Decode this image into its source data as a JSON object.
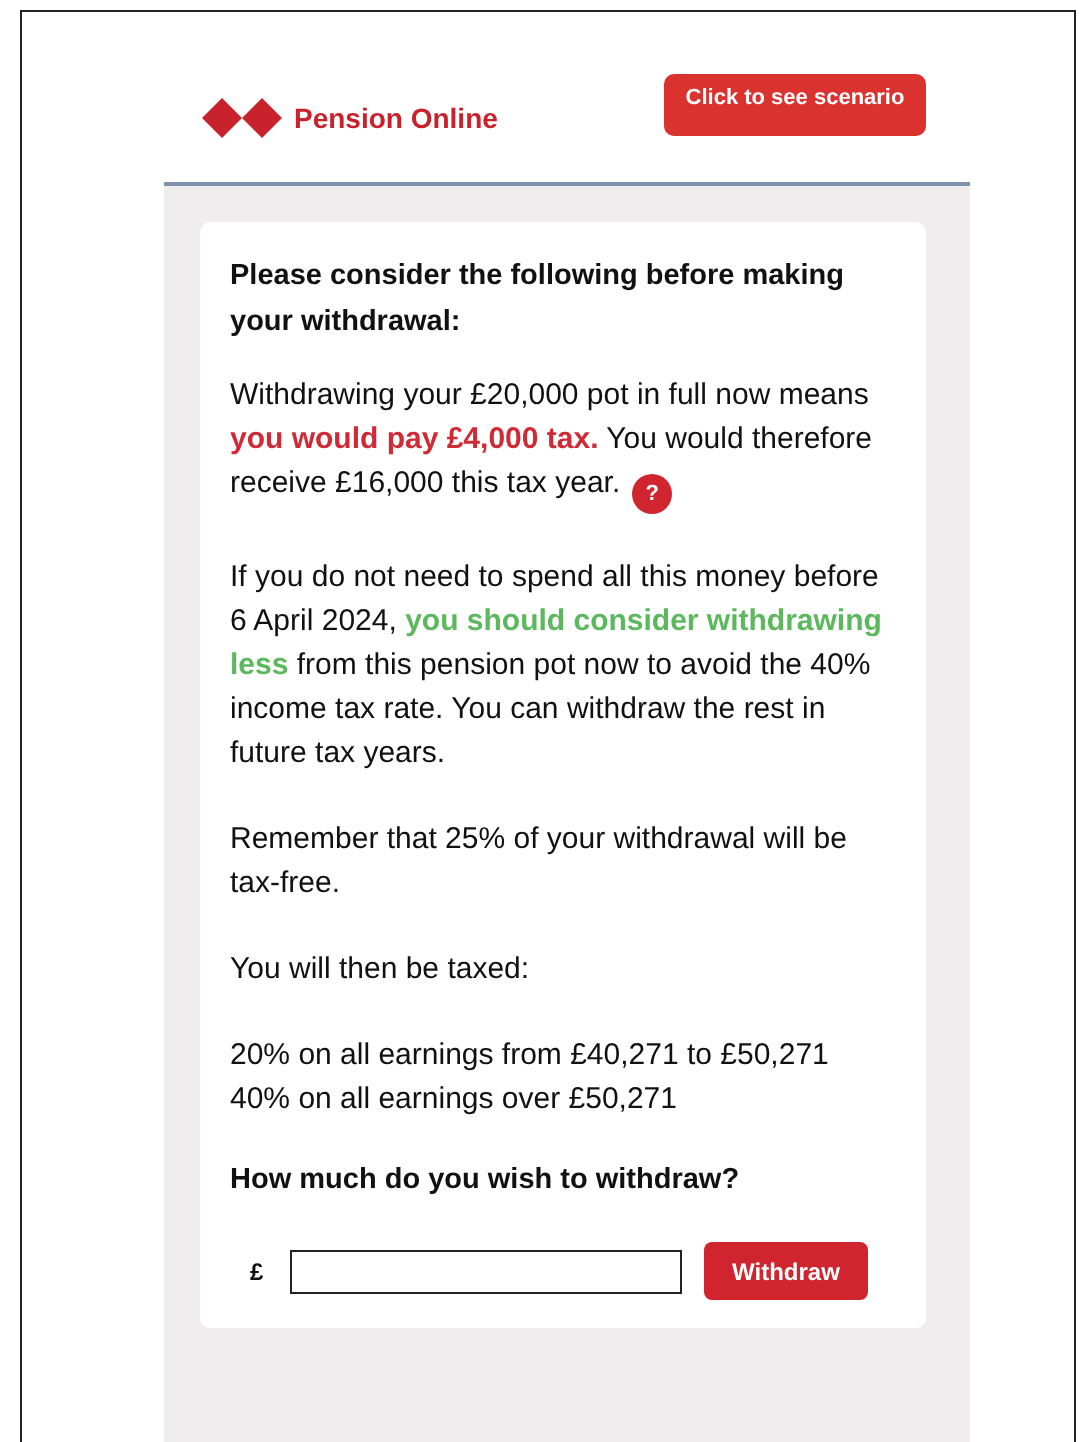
{
  "header": {
    "brand": "Pension Online",
    "scenario_button": "Click to see scenario"
  },
  "card": {
    "heading": "Please consider the following before making your withdrawal:",
    "paragraphs": [
      {
        "segments": [
          {
            "text": "Withdrawing your £20,000 pot in full now means "
          },
          {
            "text": "you would pay £4,000 tax.",
            "color": "#d02a37"
          },
          {
            "text": " You would therefore receive £16,000 this tax year."
          }
        ],
        "help": "?"
      },
      {
        "segments": [
          {
            "text": "If you do not need to spend all this money before 6 April 2024, "
          },
          {
            "text": "you should consider withdrawing less",
            "color": "#5cb85c"
          },
          {
            "text": " from this pension pot now to avoid the 40% income tax rate. You can withdraw the rest in future tax years."
          }
        ]
      },
      {
        "segments": [
          {
            "text": "Remember that 25% of your withdrawal will be tax-free."
          }
        ]
      },
      {
        "segments": [
          {
            "text": "You will then be taxed:"
          }
        ]
      }
    ],
    "rates": [
      "20% on all earnings from £40,271 to £50,271",
      "40% on all earnings over £50,271"
    ],
    "question": "How much do you wish to withdraw?",
    "currency": "£",
    "withdraw_button": "Withdraw"
  }
}
